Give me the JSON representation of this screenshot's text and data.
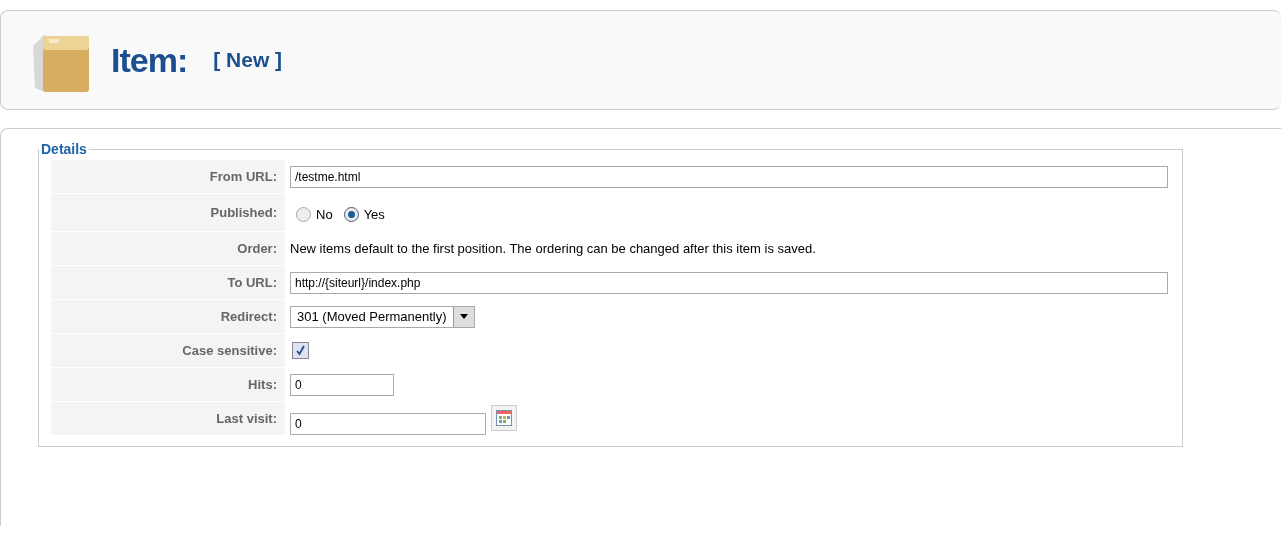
{
  "header": {
    "title": "Item:",
    "subtitle": "[ New ]"
  },
  "details": {
    "legend": "Details",
    "rows": [
      {
        "kind": "url",
        "label": "From URL:",
        "value": "/testme.html"
      },
      {
        "kind": "radio",
        "label": "Published:",
        "options": [
          {
            "label": "No",
            "selected": false
          },
          {
            "label": "Yes",
            "selected": true
          }
        ]
      },
      {
        "kind": "note",
        "label": "Order:",
        "text": "New items default to the first position. The ordering can be changed after this item is saved."
      },
      {
        "kind": "url",
        "label": "To URL:",
        "value": "http://{siteurl}/index.php"
      },
      {
        "kind": "select",
        "label": "Redirect:",
        "value": "301 (Moved Permanently)"
      },
      {
        "kind": "checkbox",
        "label": "Case sensitive:",
        "checked": true
      },
      {
        "kind": "count",
        "label": "Hits:",
        "value": "0"
      },
      {
        "kind": "date",
        "label": "Last visit:",
        "value": "0"
      }
    ]
  }
}
